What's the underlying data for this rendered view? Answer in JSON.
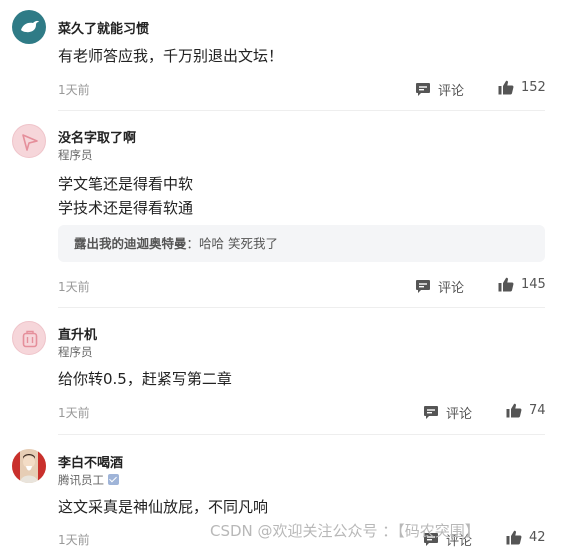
{
  "comments": [
    {
      "username": "菜久了就能习惯",
      "role": "",
      "lines": [
        "有老师答应我，千万别退出文坛！"
      ],
      "time": "1天前",
      "comment_label": "评论",
      "likes": "152"
    },
    {
      "username": "没名字取了啊",
      "role": "程序员",
      "lines": [
        "学文笔还是得看中软",
        "学技术还是得看软通"
      ],
      "reply": {
        "name": "露出我的迪迦奥特曼",
        "text": "：哈哈 笑死我了"
      },
      "time": "1天前",
      "comment_label": "评论",
      "likes": "145"
    },
    {
      "username": "直升机",
      "role": "程序员",
      "lines": [
        "给你转0.5，赶紧写第二章"
      ],
      "time": "1天前",
      "comment_label": "评论",
      "likes": "74"
    },
    {
      "username": "李白不喝酒",
      "role": "腾讯员工",
      "lines": [
        "这文采真是神仙放屁，不同凡响"
      ],
      "time": "1天前",
      "comment_label": "评论",
      "likes": "42"
    }
  ],
  "watermark": "CSDN @欢迎关注公众号 ：【码农突围】",
  "colors": {
    "avatar_teal": "#2f7b86",
    "avatar_pink": "#f6d6da",
    "muted": "#999999",
    "reply_bg": "#f4f5f7"
  }
}
